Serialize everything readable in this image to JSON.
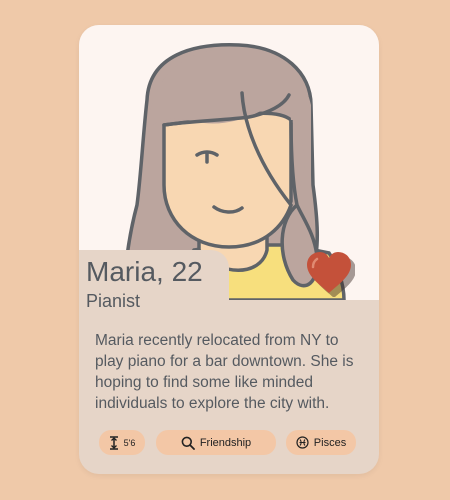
{
  "profile": {
    "name_age": "Maria, 22",
    "occupation": "Pianist",
    "bio": "Maria recently relocated from NY to play piano for a bar downtown. She is hoping to find some like minded individuals to explore the city with."
  },
  "tags": {
    "height": "5'6",
    "looking_for": "Friendship",
    "zodiac": "Pisces"
  },
  "icons": {
    "height": "height-icon",
    "looking_for": "search-icon",
    "zodiac": "pisces-icon",
    "like": "heart-icon"
  },
  "colors": {
    "background": "#efc9a9",
    "card": "#e6d5c8",
    "tag": "#f3c7a6",
    "heart": "#c4513a",
    "text": "#555a60"
  }
}
